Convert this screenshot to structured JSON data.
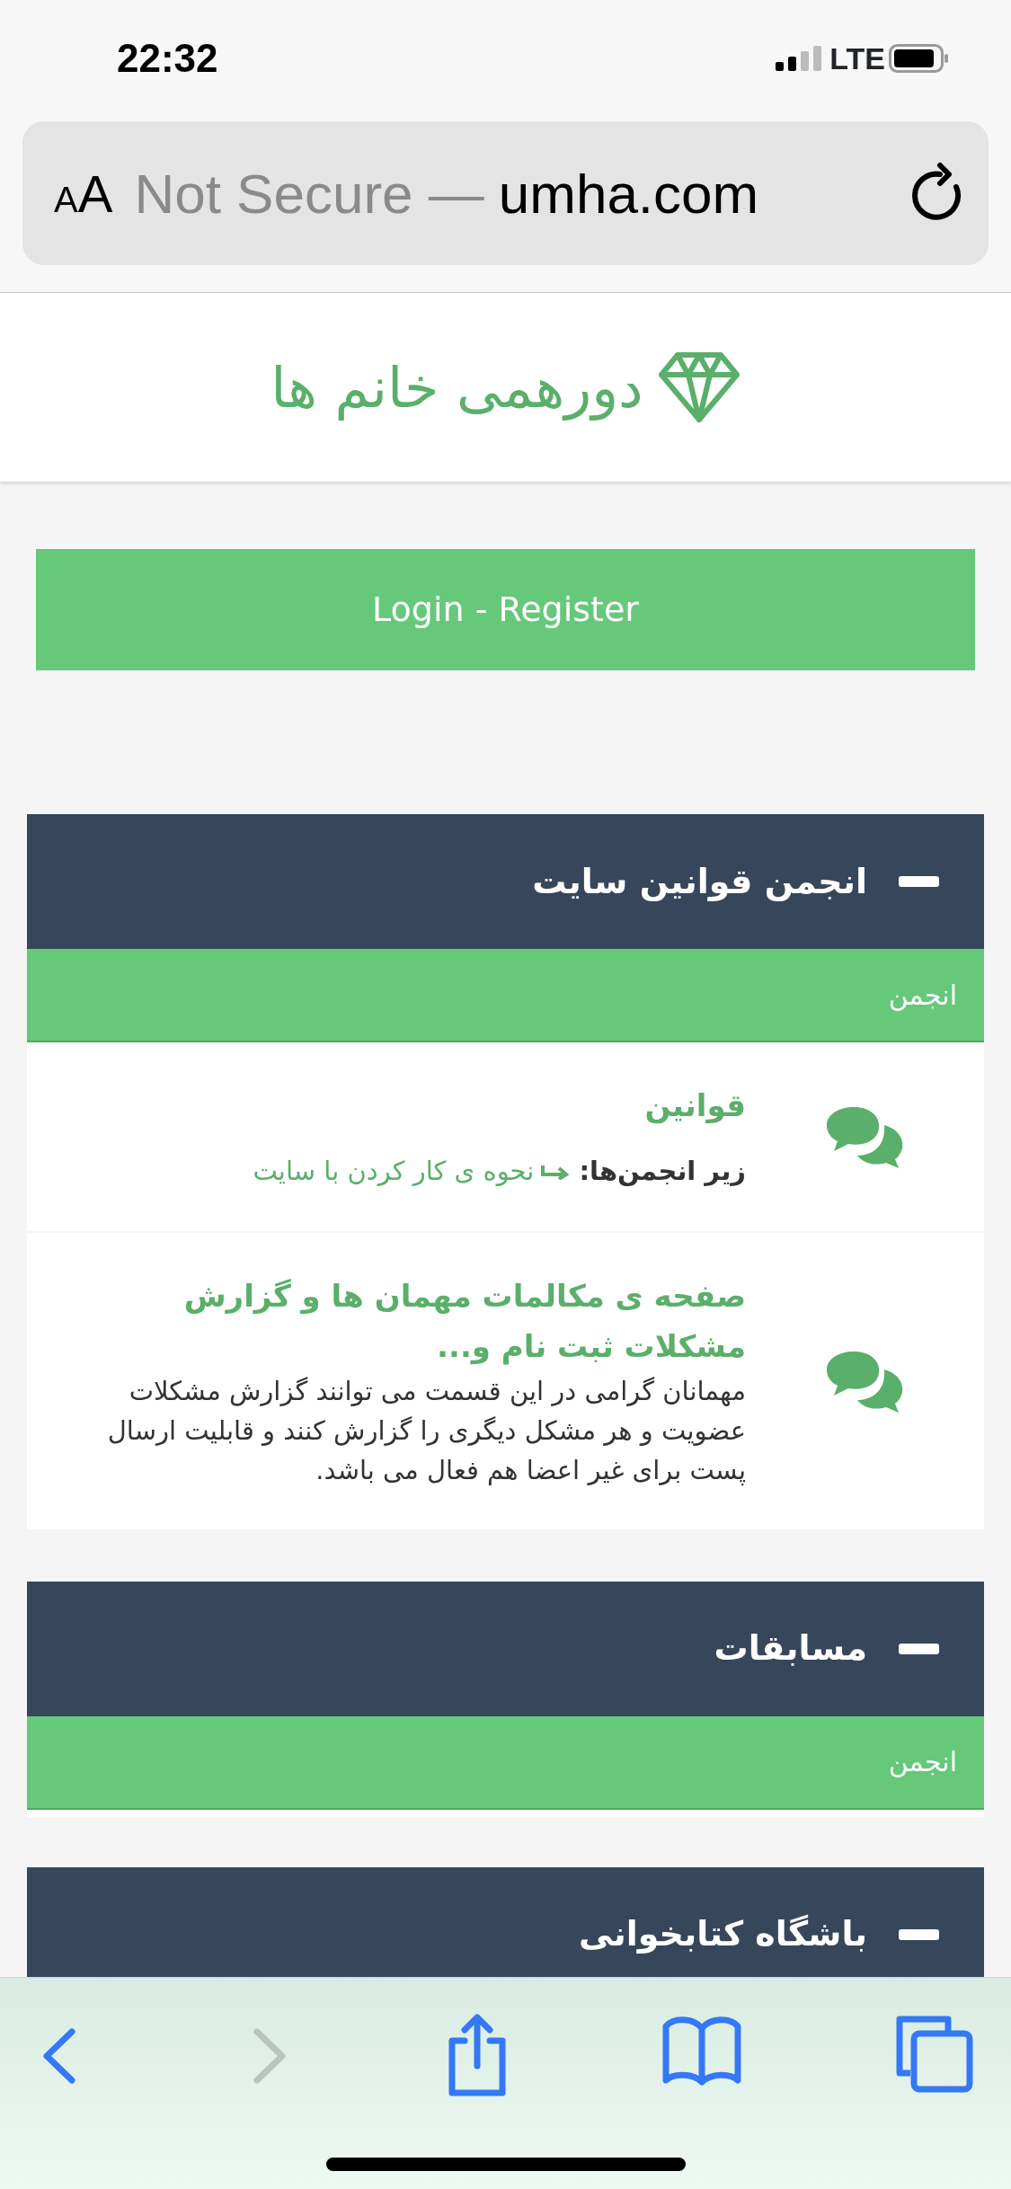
{
  "status_bar": {
    "time": "22:32",
    "network": "LTE"
  },
  "address_bar": {
    "text_size_button": "AA",
    "security": "Not Secure —",
    "domain": "umha.com"
  },
  "site": {
    "title": "دورهمی خانم ها"
  },
  "login_button": "Login - Register",
  "sections": [
    {
      "title": "انجمن قوانین سایت",
      "expanded": true,
      "subheader": "انجمن",
      "forums": [
        {
          "title": "قوانین",
          "subforums_label": "زیر انجمن‌ها:",
          "subforums": [
            "نحوه ی کار کردن با سایت"
          ]
        },
        {
          "title": "صفحه ی مکالمات مهمان ها و گزارش مشکلات ثبت نام و...",
          "description": "مهمانان گرامی در این قسمت می توانند گزارش مشکلات عضویت و هر مشکل دیگری را گزارش کنند و قابلیت ارسال پست برای غیر اعضا هم فعال می باشد."
        }
      ]
    },
    {
      "title": "مسابقات",
      "expanded": true,
      "subheader": "انجمن"
    },
    {
      "title": "باشگاه کتابخوانی",
      "expanded": true
    }
  ],
  "toolbar": {
    "back": {
      "disabled": false
    },
    "forward": {
      "disabled": true
    }
  }
}
